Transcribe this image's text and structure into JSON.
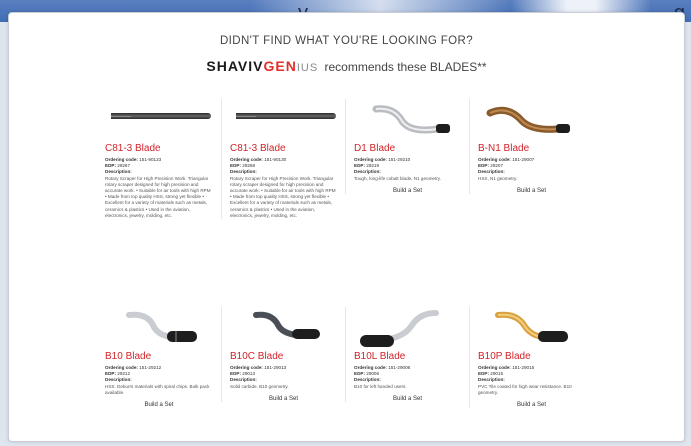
{
  "colors": {
    "title_red": "#d2232a",
    "header_blue": "#3e6db4"
  },
  "top_strip": {
    "left_fragment": "y",
    "right_fragment": "g"
  },
  "header": {
    "heading": "DIDN'T FIND WHAT YOU'RE LOOKING FOR?",
    "brand_part1": "SHAVIV",
    "brand_part2": "GEN",
    "brand_part3": "IUS",
    "recommend_text": "recommends these BLADES**"
  },
  "products": [
    {
      "name": "C81-3 Blade",
      "ordering_label": "Ordering code:",
      "ordering_code": "151-90123",
      "edp_label": "EDP:",
      "edp": "29267",
      "description_label": "Description:",
      "description": "Rotary Scraper for High Precision Work. Triangular rotary scraper designed for high precision and accurate work. • Suitable for air tools with high RPM • Made from top quality HSS, strong yet flexible • Excellent for a variety of materials such as metals, ceramics & plastics • Used in the aviation, electronics, jewelry, molding, etc.",
      "build_label": "",
      "image": "scraper-blade"
    },
    {
      "name": "C81-3 Blade",
      "ordering_label": "Ordering code:",
      "ordering_code": "151-90130",
      "edp_label": "EDP:",
      "edp": "29268",
      "description_label": "Description:",
      "description": "Rotary Scraper for High Precision Work. Triangular rotary scraper designed for high precision and accurate work. • Suitable for air tools with high RPM • Made from top quality HSS, strong yet flexible • Excellent for a variety of materials such as metals, ceramics & plastics • Used in the aviation, electronics, jewelry, molding, etc.",
      "build_label": "",
      "image": "scraper-blade"
    },
    {
      "name": "D1 Blade",
      "ordering_label": "Ordering code:",
      "ordering_code": "151-29210",
      "edp_label": "EDP:",
      "edp": "29219",
      "description_label": "Description:",
      "description": "Tough, long-life cobalt blade, N1 geometry.",
      "build_label": "Build a Set",
      "image": "curved-blade-silver"
    },
    {
      "name": "B-N1 Blade",
      "ordering_label": "Ordering code:",
      "ordering_code": "151-29007",
      "edp_label": "EDP:",
      "edp": "29207",
      "description_label": "Description:",
      "description": "HSS, N1 geometry.",
      "build_label": "Build a Set",
      "image": "curved-blade-bronze"
    },
    {
      "name": "B10 Blade",
      "ordering_label": "Ordering code:",
      "ordering_code": "151-29212",
      "edp_label": "EDP:",
      "edp": "29212",
      "description_label": "Description:",
      "description": "HSS. Deburrs materials with spiral chips. Bulk pack available.",
      "build_label": "Build a Set",
      "image": "handle-blade-silver"
    },
    {
      "name": "B10C Blade",
      "ordering_label": "Ordering code:",
      "ordering_code": "151-29013",
      "edp_label": "EDP:",
      "edp": "29013",
      "description_label": "Description:",
      "description": "Solid carbide. B10 geometry.",
      "build_label": "Build a Set",
      "image": "handle-blade-dark"
    },
    {
      "name": "B10L Blade",
      "ordering_label": "Ordering code:",
      "ordering_code": "151-29006",
      "edp_label": "EDP:",
      "edp": "29006",
      "description_label": "Description:",
      "description": "B10 for left handed users.",
      "build_label": "Build a Set",
      "image": "handle-blade-silver"
    },
    {
      "name": "B10P Blade",
      "ordering_label": "Ordering code:",
      "ordering_code": "151-29015",
      "edp_label": "EDP:",
      "edp": "29015",
      "description_label": "Description:",
      "description": "PVC Tile coated for high wear resistance. B10 geometry.",
      "build_label": "Build a Set",
      "image": "handle-blade-gold"
    }
  ]
}
